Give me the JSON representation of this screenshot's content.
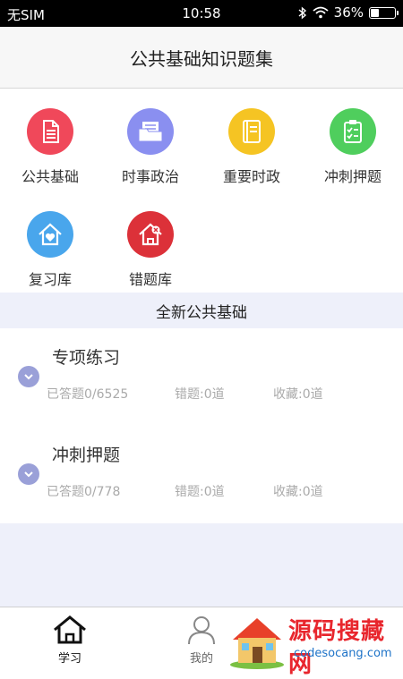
{
  "status": {
    "carrier": "无SIM",
    "time": "10:58",
    "battery": "36%",
    "battery_level": 0.36
  },
  "header": {
    "title": "公共基础知识题集"
  },
  "tiles": [
    {
      "label": "公共基础",
      "icon": "document-icon",
      "color": "#f0485a"
    },
    {
      "label": "时事政治",
      "icon": "folder-icon",
      "color": "#8a8ff0"
    },
    {
      "label": "重要时政",
      "icon": "book-icon",
      "color": "#f5c423"
    },
    {
      "label": "冲刺押题",
      "icon": "clipboard-icon",
      "color": "#4fce5d"
    },
    {
      "label": "复习库",
      "icon": "home-heart-icon",
      "color": "#49a6ec"
    },
    {
      "label": "错题库",
      "icon": "home-x-icon",
      "color": "#dc3139"
    }
  ],
  "section": {
    "title": "全新公共基础"
  },
  "items": [
    {
      "title": "专项练习",
      "answered": "已答题0/6525",
      "wrong": "错题:0道",
      "fav": "收藏:0道"
    },
    {
      "title": "冲刺押题",
      "answered": "已答题0/778",
      "wrong": "错题:0道",
      "fav": "收藏:0道"
    }
  ],
  "tabs": [
    {
      "label": "学习",
      "icon": "home-icon",
      "active": true
    },
    {
      "label": "我的",
      "icon": "user-icon",
      "active": false
    }
  ],
  "watermark": {
    "text": "源码搜藏网",
    "url": "codesocang.com"
  },
  "colors": {
    "accent": "#9aa0d8",
    "section_bg": "#eef0fa"
  }
}
